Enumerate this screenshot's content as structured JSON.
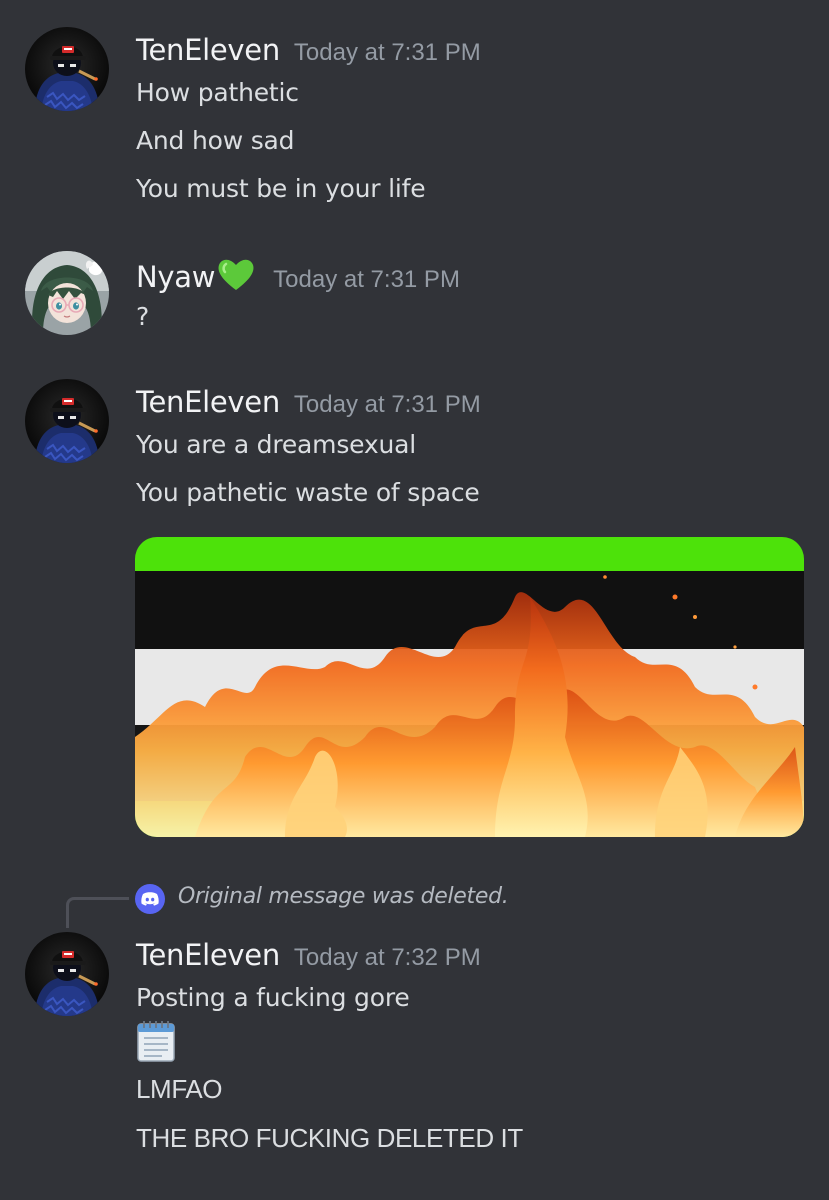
{
  "messages": [
    {
      "username": "TenEleven",
      "timestamp": "Today at 7:31 PM",
      "avatar": "teneleven-avatar",
      "lines": [
        "How pathetic",
        "And how sad",
        "You must be in your life"
      ]
    },
    {
      "username": "Nyaw",
      "username_emoji": "green-heart-emoji",
      "timestamp": "Today at 7:31 PM",
      "avatar": "nyaw-anime-avatar",
      "lines": [
        "?"
      ]
    },
    {
      "username": "TenEleven",
      "timestamp": "Today at 7:31 PM",
      "avatar": "teneleven-avatar",
      "lines": [
        "You are a dreamsexual",
        "You pathetic waste of space"
      ],
      "attachment": {
        "type": "image",
        "description": "burning-flag-image",
        "colors": [
          "#4de20a",
          "#111111",
          "#e6e6e6",
          "#4de20a"
        ]
      }
    },
    {
      "reply": {
        "icon": "discord-logo-icon",
        "text": "Original message was deleted."
      },
      "username": "TenEleven",
      "timestamp": "Today at 7:32 PM",
      "avatar": "teneleven-avatar",
      "lines": [
        "Posting a fucking gore",
        "LMFAO",
        "THE BRO FUCKING DELETED IT"
      ],
      "inline_emoji": "spiral-notepad-emoji"
    }
  ],
  "colors": {
    "background": "#313338",
    "username": "#f2f3f5",
    "timestamp": "#949ba4",
    "text": "#dbdee1",
    "blurple": "#5865f2"
  }
}
